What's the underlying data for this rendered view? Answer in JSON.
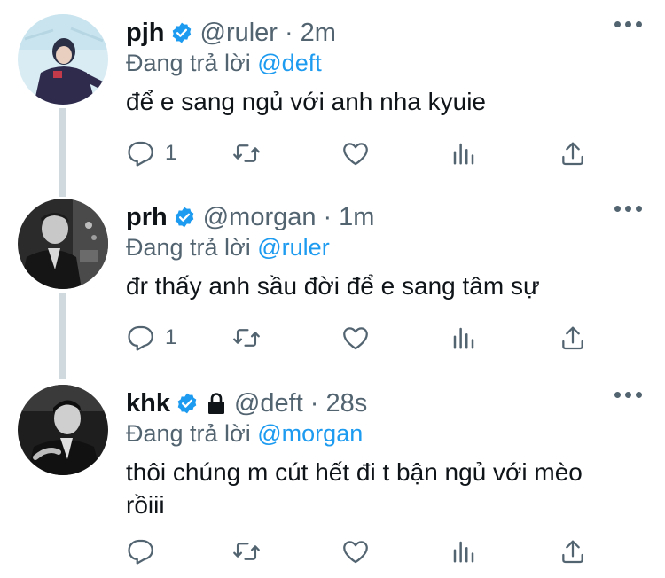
{
  "tweets": [
    {
      "name": "pjh",
      "handle": "@ruler",
      "separator": "·",
      "time": "2m",
      "reply_prefix": "Đang trả lời ",
      "reply_to": "@deft",
      "text": "để e sang ngủ với anh nha kyuie",
      "reply_count": "1",
      "locked": false
    },
    {
      "name": "prh",
      "handle": "@morgan",
      "separator": "·",
      "time": "1m",
      "reply_prefix": "Đang trả lời ",
      "reply_to": "@ruler",
      "text": "đr thấy anh sầu đời để e sang tâm sự",
      "reply_count": "1",
      "locked": false
    },
    {
      "name": "khk",
      "handle": "@deft",
      "separator": "·",
      "time": "28s",
      "reply_prefix": "Đang trả lời ",
      "reply_to": "@morgan",
      "text": "thôi chúng m cút hết đi t bận ngủ với mèo rồiii",
      "reply_count": "",
      "locked": true
    }
  ],
  "icons": {
    "verified": "verified-badge-icon",
    "lock": "lock-icon",
    "reply": "reply-icon",
    "retweet": "retweet-icon",
    "like": "like-icon",
    "views": "views-icon",
    "share": "share-icon",
    "more": "more-icon"
  },
  "colors": {
    "verified": "#1d9bf0",
    "mention": "#1d9bf0",
    "secondary_text": "#536471",
    "thread_line": "#cfd9de"
  }
}
